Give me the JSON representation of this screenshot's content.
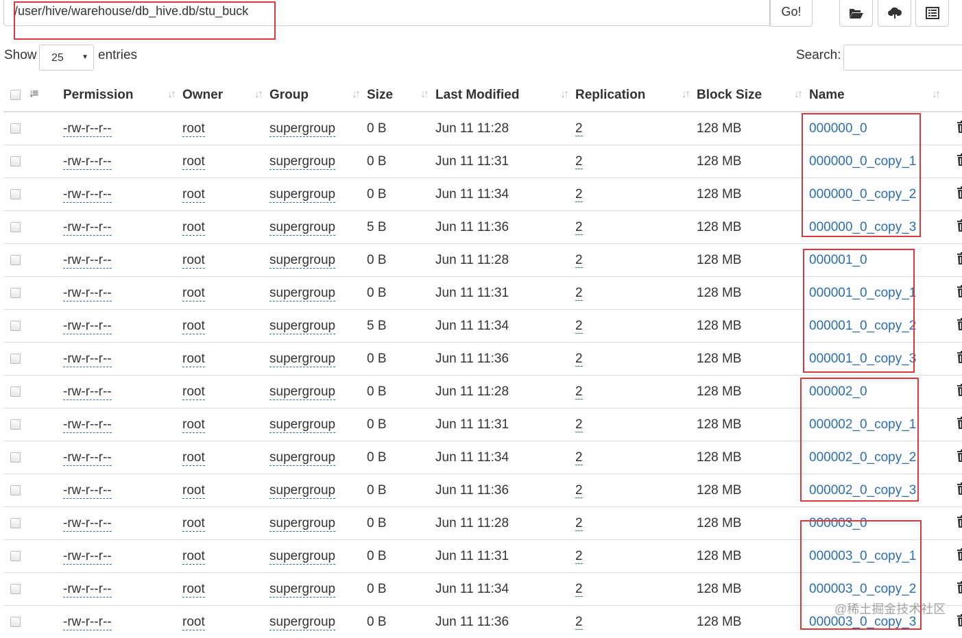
{
  "path": {
    "value": "/user/hive/warehouse/db_hive.db/stu_buck",
    "go_label": "Go!",
    "buttons": [
      "folder-open-icon",
      "cloud-upload-icon",
      "list-icon"
    ]
  },
  "controls": {
    "show_label": "Show",
    "length_value": "25",
    "entries_label": "entries",
    "search_label": "Search:"
  },
  "columns": [
    "Permission",
    "Owner",
    "Group",
    "Size",
    "Last Modified",
    "Replication",
    "Block Size",
    "Name"
  ],
  "rows": [
    {
      "permission": "-rw-r--r--",
      "owner": "root",
      "group": "supergroup",
      "size": "0 B",
      "modified": "Jun 11 11:28",
      "replication": "2",
      "block_size": "128 MB",
      "name": "000000_0"
    },
    {
      "permission": "-rw-r--r--",
      "owner": "root",
      "group": "supergroup",
      "size": "0 B",
      "modified": "Jun 11 11:31",
      "replication": "2",
      "block_size": "128 MB",
      "name": "000000_0_copy_1"
    },
    {
      "permission": "-rw-r--r--",
      "owner": "root",
      "group": "supergroup",
      "size": "0 B",
      "modified": "Jun 11 11:34",
      "replication": "2",
      "block_size": "128 MB",
      "name": "000000_0_copy_2"
    },
    {
      "permission": "-rw-r--r--",
      "owner": "root",
      "group": "supergroup",
      "size": "5 B",
      "modified": "Jun 11 11:36",
      "replication": "2",
      "block_size": "128 MB",
      "name": "000000_0_copy_3"
    },
    {
      "permission": "-rw-r--r--",
      "owner": "root",
      "group": "supergroup",
      "size": "0 B",
      "modified": "Jun 11 11:28",
      "replication": "2",
      "block_size": "128 MB",
      "name": "000001_0"
    },
    {
      "permission": "-rw-r--r--",
      "owner": "root",
      "group": "supergroup",
      "size": "0 B",
      "modified": "Jun 11 11:31",
      "replication": "2",
      "block_size": "128 MB",
      "name": "000001_0_copy_1"
    },
    {
      "permission": "-rw-r--r--",
      "owner": "root",
      "group": "supergroup",
      "size": "5 B",
      "modified": "Jun 11 11:34",
      "replication": "2",
      "block_size": "128 MB",
      "name": "000001_0_copy_2"
    },
    {
      "permission": "-rw-r--r--",
      "owner": "root",
      "group": "supergroup",
      "size": "0 B",
      "modified": "Jun 11 11:36",
      "replication": "2",
      "block_size": "128 MB",
      "name": "000001_0_copy_3"
    },
    {
      "permission": "-rw-r--r--",
      "owner": "root",
      "group": "supergroup",
      "size": "0 B",
      "modified": "Jun 11 11:28",
      "replication": "2",
      "block_size": "128 MB",
      "name": "000002_0"
    },
    {
      "permission": "-rw-r--r--",
      "owner": "root",
      "group": "supergroup",
      "size": "0 B",
      "modified": "Jun 11 11:31",
      "replication": "2",
      "block_size": "128 MB",
      "name": "000002_0_copy_1"
    },
    {
      "permission": "-rw-r--r--",
      "owner": "root",
      "group": "supergroup",
      "size": "0 B",
      "modified": "Jun 11 11:34",
      "replication": "2",
      "block_size": "128 MB",
      "name": "000002_0_copy_2"
    },
    {
      "permission": "-rw-r--r--",
      "owner": "root",
      "group": "supergroup",
      "size": "0 B",
      "modified": "Jun 11 11:36",
      "replication": "2",
      "block_size": "128 MB",
      "name": "000002_0_copy_3"
    },
    {
      "permission": "-rw-r--r--",
      "owner": "root",
      "group": "supergroup",
      "size": "0 B",
      "modified": "Jun 11 11:28",
      "replication": "2",
      "block_size": "128 MB",
      "name": "000003_0"
    },
    {
      "permission": "-rw-r--r--",
      "owner": "root",
      "group": "supergroup",
      "size": "0 B",
      "modified": "Jun 11 11:31",
      "replication": "2",
      "block_size": "128 MB",
      "name": "000003_0_copy_1"
    },
    {
      "permission": "-rw-r--r--",
      "owner": "root",
      "group": "supergroup",
      "size": "0 B",
      "modified": "Jun 11 11:34",
      "replication": "2",
      "block_size": "128 MB",
      "name": "000003_0_copy_2"
    },
    {
      "permission": "-rw-r--r--",
      "owner": "root",
      "group": "supergroup",
      "size": "0 B",
      "modified": "Jun 11 11:36",
      "replication": "2",
      "block_size": "128 MB",
      "name": "000003_0_copy_3"
    }
  ],
  "watermark": "@稀土掘金技术社区",
  "colors": {
    "link": "#2a6db0",
    "highlight_box": "#d9363e",
    "border": "#dddddd"
  }
}
